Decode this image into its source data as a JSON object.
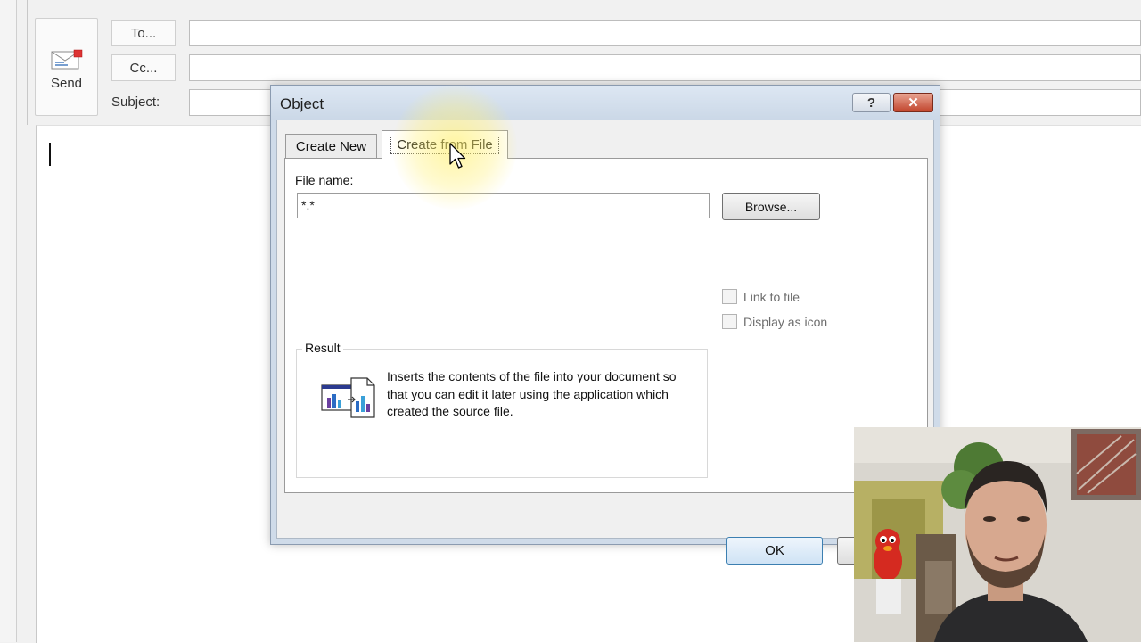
{
  "compose": {
    "send_label": "Send",
    "to_label": "To...",
    "cc_label": "Cc...",
    "subject_label": "Subject:",
    "to_value": "",
    "cc_value": "",
    "subject_value": ""
  },
  "dialog": {
    "title": "Object",
    "help_label": "?",
    "close_label": "✕",
    "tabs": [
      {
        "label": "Create New",
        "selected": false
      },
      {
        "label": "Create from File",
        "selected": true
      }
    ],
    "file_name_label": "File name:",
    "file_name_value": "*.*",
    "browse_label": "Browse...",
    "link_to_file_label": "Link to file",
    "display_as_icon_label": "Display as icon",
    "result_label": "Result",
    "result_text": "Inserts the contents of the file into your document so that you can edit it later using the application which created the source file.",
    "ok_label": "OK",
    "cancel_label": ""
  },
  "icons": {
    "send": "send-envelope-icon",
    "result": "embedded-file-chart-icon",
    "cursor": "mouse-pointer-icon"
  },
  "colors": {
    "dialog_frame": "#cfdbe9",
    "ok_border": "#3c7fb1",
    "close_button": "#c2452d",
    "cursor_highlight": "#fff06e"
  }
}
